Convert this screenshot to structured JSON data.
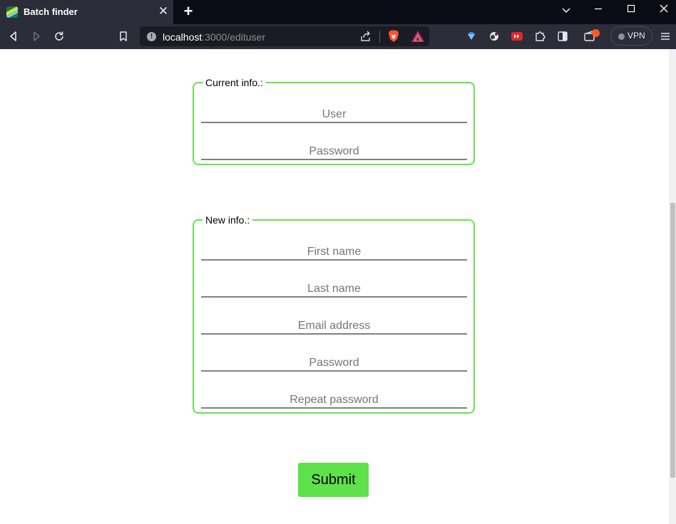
{
  "browser": {
    "tab_title": "Batch finder",
    "tab_close": "✕",
    "new_tab": "+",
    "url_host": "localhost",
    "url_rest": ":3000/edituser",
    "vpn_label": "VPN"
  },
  "current_info": {
    "legend": "Current info.:",
    "user_placeholder": "User",
    "password_placeholder": "Password"
  },
  "new_info": {
    "legend": "New info.:",
    "first_name_placeholder": "First name",
    "last_name_placeholder": "Last name",
    "email_placeholder": "Email address",
    "password_placeholder": "Password",
    "repeat_password_placeholder": "Repeat password"
  },
  "submit_label": "Submit",
  "icons": {
    "favicon": "batch-finder-favicon",
    "back": "back-arrow-icon",
    "forward": "forward-arrow-icon",
    "reload": "reload-icon",
    "bookmark": "bookmark-icon",
    "site_info": "site-info-icon",
    "share": "share-icon",
    "brave_shield": "brave-shield-icon",
    "brave_rewards": "brave-rewards-icon",
    "extensions": "extensions-icon",
    "sidebar": "sidebar-icon",
    "wallet": "wallet-icon",
    "menu": "hamburger-menu-icon"
  },
  "colors": {
    "fieldset_border": "#67e34f",
    "submit_bg": "#5ee14a",
    "chrome_dark": "#0b0b15",
    "toolbar": "#2b2d39"
  }
}
